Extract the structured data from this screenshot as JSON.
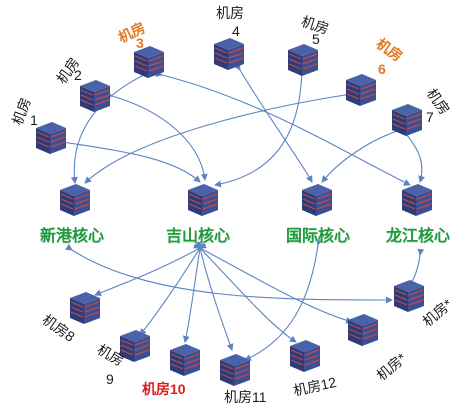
{
  "colors": {
    "core_label": "#1f9a3f",
    "highlight_orange": "#e07b22",
    "highlight_red": "#e01a1a",
    "link": "#5b84c4",
    "building_top": "#4a63a8",
    "building_side": "#2c3c78",
    "building_stripe": "#c04a4a"
  },
  "cores": {
    "xingang": "新港核心",
    "jishan": "吉山核心",
    "guoji": "国际核心",
    "longjiang": "龙江核心"
  },
  "rooms": {
    "r1": {
      "label": "机房",
      "num": "1"
    },
    "r2": {
      "label": "机房",
      "num": "2"
    },
    "r3": {
      "label": "机房",
      "num": "3"
    },
    "r4": {
      "label": "机房",
      "num": "4"
    },
    "r5": {
      "label": "机房",
      "num": "5"
    },
    "r6": {
      "label": "机房",
      "num": "6"
    },
    "r7": {
      "label": "机房",
      "num": "7"
    },
    "r8": {
      "label": "机房8"
    },
    "r9": {
      "label": "机房",
      "num": "9"
    },
    "r10": {
      "label": "机房10"
    },
    "r11": {
      "label": "机房11"
    },
    "r12": {
      "label": "机房12"
    },
    "rs1": {
      "label": "机房*"
    },
    "rs2": {
      "label": "机房*"
    }
  }
}
